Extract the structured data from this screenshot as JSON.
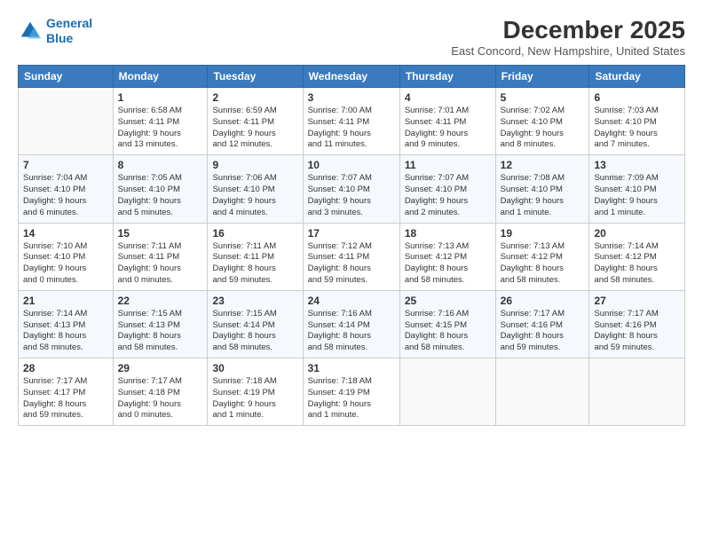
{
  "logo": {
    "line1": "General",
    "line2": "Blue"
  },
  "title": "December 2025",
  "subtitle": "East Concord, New Hampshire, United States",
  "header_days": [
    "Sunday",
    "Monday",
    "Tuesday",
    "Wednesday",
    "Thursday",
    "Friday",
    "Saturday"
  ],
  "weeks": [
    [
      {
        "day": "",
        "info": ""
      },
      {
        "day": "1",
        "info": "Sunrise: 6:58 AM\nSunset: 4:11 PM\nDaylight: 9 hours\nand 13 minutes."
      },
      {
        "day": "2",
        "info": "Sunrise: 6:59 AM\nSunset: 4:11 PM\nDaylight: 9 hours\nand 12 minutes."
      },
      {
        "day": "3",
        "info": "Sunrise: 7:00 AM\nSunset: 4:11 PM\nDaylight: 9 hours\nand 11 minutes."
      },
      {
        "day": "4",
        "info": "Sunrise: 7:01 AM\nSunset: 4:11 PM\nDaylight: 9 hours\nand 9 minutes."
      },
      {
        "day": "5",
        "info": "Sunrise: 7:02 AM\nSunset: 4:10 PM\nDaylight: 9 hours\nand 8 minutes."
      },
      {
        "day": "6",
        "info": "Sunrise: 7:03 AM\nSunset: 4:10 PM\nDaylight: 9 hours\nand 7 minutes."
      }
    ],
    [
      {
        "day": "7",
        "info": "Sunrise: 7:04 AM\nSunset: 4:10 PM\nDaylight: 9 hours\nand 6 minutes."
      },
      {
        "day": "8",
        "info": "Sunrise: 7:05 AM\nSunset: 4:10 PM\nDaylight: 9 hours\nand 5 minutes."
      },
      {
        "day": "9",
        "info": "Sunrise: 7:06 AM\nSunset: 4:10 PM\nDaylight: 9 hours\nand 4 minutes."
      },
      {
        "day": "10",
        "info": "Sunrise: 7:07 AM\nSunset: 4:10 PM\nDaylight: 9 hours\nand 3 minutes."
      },
      {
        "day": "11",
        "info": "Sunrise: 7:07 AM\nSunset: 4:10 PM\nDaylight: 9 hours\nand 2 minutes."
      },
      {
        "day": "12",
        "info": "Sunrise: 7:08 AM\nSunset: 4:10 PM\nDaylight: 9 hours\nand 1 minute."
      },
      {
        "day": "13",
        "info": "Sunrise: 7:09 AM\nSunset: 4:10 PM\nDaylight: 9 hours\nand 1 minute."
      }
    ],
    [
      {
        "day": "14",
        "info": "Sunrise: 7:10 AM\nSunset: 4:10 PM\nDaylight: 9 hours\nand 0 minutes."
      },
      {
        "day": "15",
        "info": "Sunrise: 7:11 AM\nSunset: 4:11 PM\nDaylight: 9 hours\nand 0 minutes."
      },
      {
        "day": "16",
        "info": "Sunrise: 7:11 AM\nSunset: 4:11 PM\nDaylight: 8 hours\nand 59 minutes."
      },
      {
        "day": "17",
        "info": "Sunrise: 7:12 AM\nSunset: 4:11 PM\nDaylight: 8 hours\nand 59 minutes."
      },
      {
        "day": "18",
        "info": "Sunrise: 7:13 AM\nSunset: 4:12 PM\nDaylight: 8 hours\nand 58 minutes."
      },
      {
        "day": "19",
        "info": "Sunrise: 7:13 AM\nSunset: 4:12 PM\nDaylight: 8 hours\nand 58 minutes."
      },
      {
        "day": "20",
        "info": "Sunrise: 7:14 AM\nSunset: 4:12 PM\nDaylight: 8 hours\nand 58 minutes."
      }
    ],
    [
      {
        "day": "21",
        "info": "Sunrise: 7:14 AM\nSunset: 4:13 PM\nDaylight: 8 hours\nand 58 minutes."
      },
      {
        "day": "22",
        "info": "Sunrise: 7:15 AM\nSunset: 4:13 PM\nDaylight: 8 hours\nand 58 minutes."
      },
      {
        "day": "23",
        "info": "Sunrise: 7:15 AM\nSunset: 4:14 PM\nDaylight: 8 hours\nand 58 minutes."
      },
      {
        "day": "24",
        "info": "Sunrise: 7:16 AM\nSunset: 4:14 PM\nDaylight: 8 hours\nand 58 minutes."
      },
      {
        "day": "25",
        "info": "Sunrise: 7:16 AM\nSunset: 4:15 PM\nDaylight: 8 hours\nand 58 minutes."
      },
      {
        "day": "26",
        "info": "Sunrise: 7:17 AM\nSunset: 4:16 PM\nDaylight: 8 hours\nand 59 minutes."
      },
      {
        "day": "27",
        "info": "Sunrise: 7:17 AM\nSunset: 4:16 PM\nDaylight: 8 hours\nand 59 minutes."
      }
    ],
    [
      {
        "day": "28",
        "info": "Sunrise: 7:17 AM\nSunset: 4:17 PM\nDaylight: 8 hours\nand 59 minutes."
      },
      {
        "day": "29",
        "info": "Sunrise: 7:17 AM\nSunset: 4:18 PM\nDaylight: 9 hours\nand 0 minutes."
      },
      {
        "day": "30",
        "info": "Sunrise: 7:18 AM\nSunset: 4:19 PM\nDaylight: 9 hours\nand 1 minute."
      },
      {
        "day": "31",
        "info": "Sunrise: 7:18 AM\nSunset: 4:19 PM\nDaylight: 9 hours\nand 1 minute."
      },
      {
        "day": "",
        "info": ""
      },
      {
        "day": "",
        "info": ""
      },
      {
        "day": "",
        "info": ""
      }
    ]
  ]
}
